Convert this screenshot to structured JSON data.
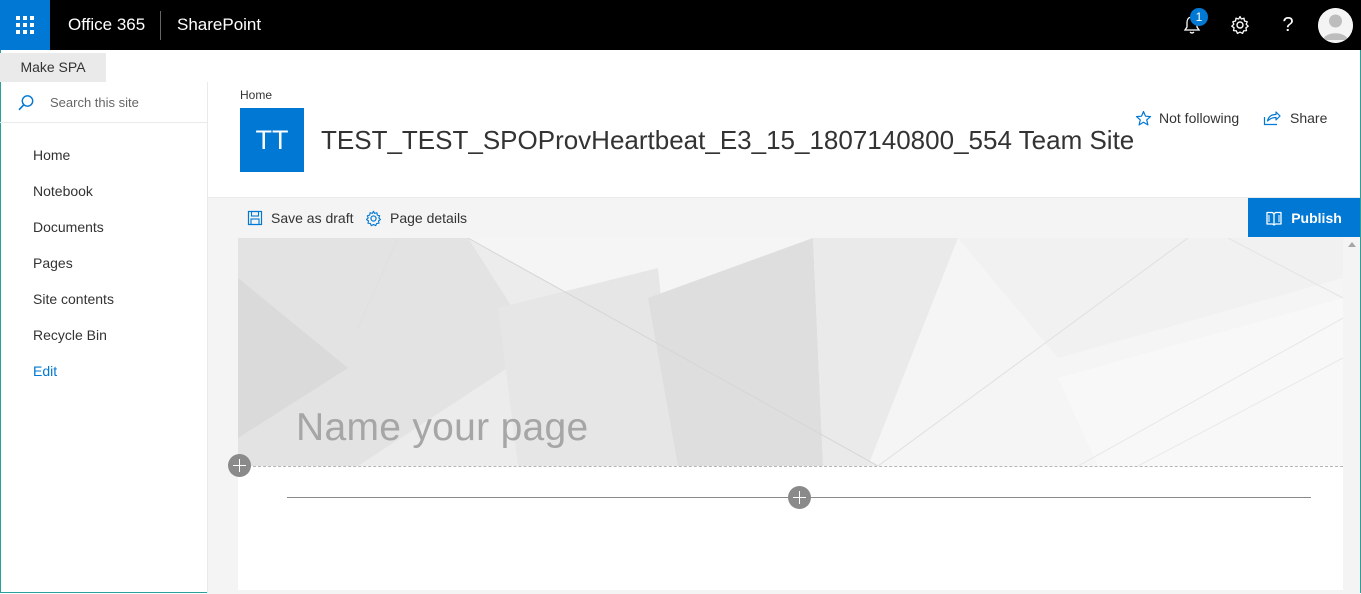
{
  "suite": {
    "brand": "Office 365",
    "app": "SharePoint",
    "notification_count": "1",
    "help_glyph": "?",
    "accent": "#0078d4"
  },
  "spa_tab": {
    "label": "Make SPA"
  },
  "nav": {
    "search_placeholder": "Search this site",
    "items": [
      {
        "label": "Home"
      },
      {
        "label": "Notebook"
      },
      {
        "label": "Documents"
      },
      {
        "label": "Pages"
      },
      {
        "label": "Site contents"
      },
      {
        "label": "Recycle Bin"
      },
      {
        "label": "Edit"
      }
    ]
  },
  "header": {
    "breadcrumb": "Home",
    "site_logo_text": "TT",
    "site_title": "TEST_TEST_SPOProvHeartbeat_E3_15_1807140800_554 Team Site",
    "follow_label": "Not following",
    "share_label": "Share"
  },
  "command_bar": {
    "save_draft_label": "Save as draft",
    "page_details_label": "Page details",
    "publish_label": "Publish"
  },
  "canvas": {
    "title_placeholder": "Name your page"
  },
  "icons": {
    "app_launcher": "waffle-icon",
    "notifications": "bell-icon",
    "settings": "gear-icon",
    "help": "help-icon",
    "search": "search-icon",
    "follow": "star-icon",
    "share": "share-icon",
    "save": "save-icon",
    "page_details": "gear-icon",
    "publish": "book-icon",
    "add": "plus-circle-icon"
  }
}
